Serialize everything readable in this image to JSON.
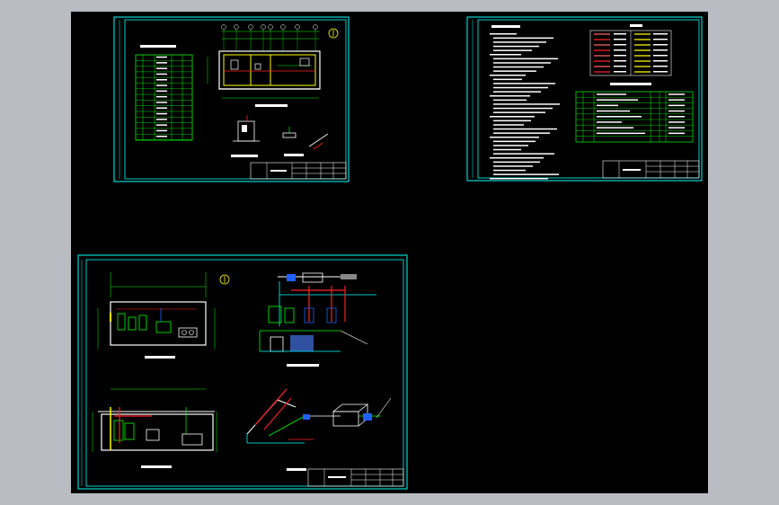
{
  "app": {
    "background": "#b9bcc2",
    "viewport_background": "#000000"
  },
  "sheets": [
    {
      "name": "sheet-top-left",
      "frame_color": "#00ffff",
      "detail_numbers": [
        "1"
      ]
    },
    {
      "name": "sheet-top-right",
      "frame_color": "#00ffff"
    },
    {
      "name": "sheet-bottom-left",
      "frame_color": "#00ffff",
      "detail_numbers": [
        "1"
      ]
    }
  ],
  "colors": {
    "frame": "#00ffff",
    "lines": "#ffffff",
    "table": "#00ff00",
    "walls": "#ffff00",
    "pipes_red": "#ff2020",
    "pipes_blue": "#2060ff",
    "pipes_green": "#00ff00"
  }
}
